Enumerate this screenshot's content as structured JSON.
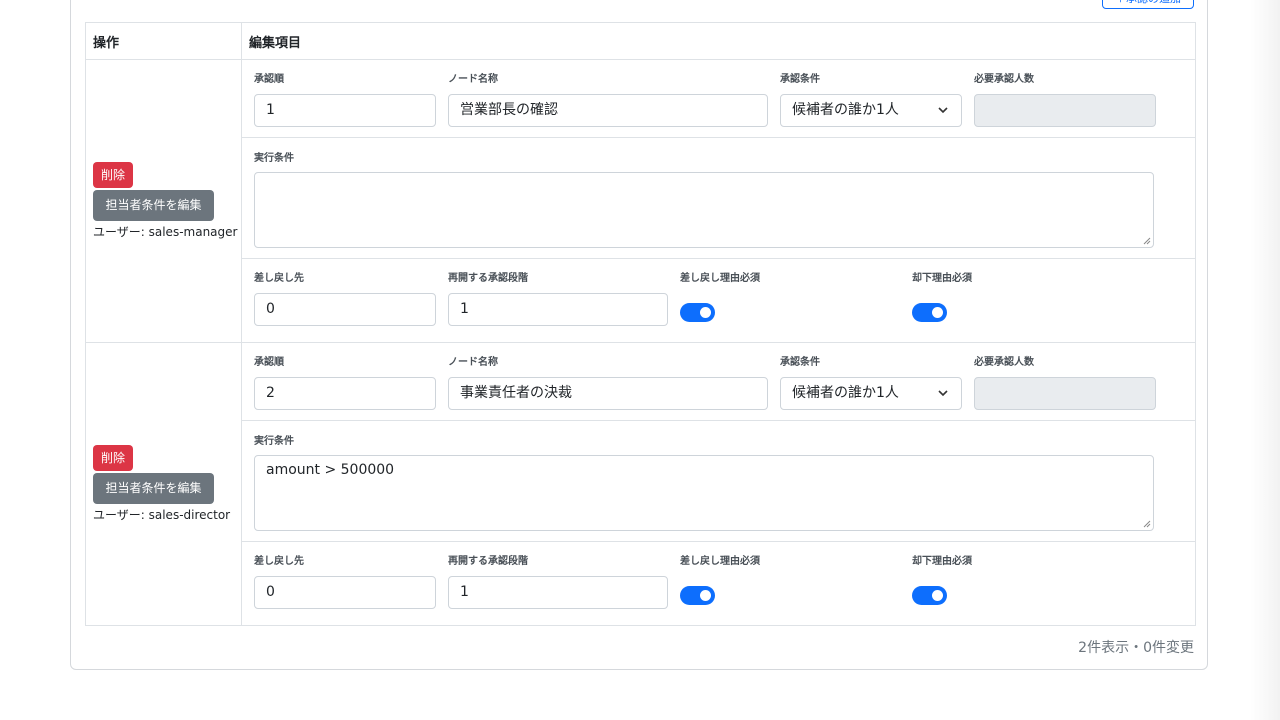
{
  "header": {
    "add_button_label": "＋承認の追加"
  },
  "table": {
    "col_ops": "操作",
    "col_edit": "編集項目"
  },
  "labels": {
    "order": "承認順",
    "node_name": "ノード名称",
    "condition": "承認条件",
    "required_count": "必要承認人数",
    "exec_condition": "実行条件",
    "sendback_to": "差し戻し先",
    "resume_stage": "再開する承認段階",
    "sendback_reason": "差し戻し理由必須",
    "reject_reason": "却下理由必須"
  },
  "buttons": {
    "delete": "削除",
    "edit_assignee": "担当者条件を編集"
  },
  "rows": [
    {
      "user": "ユーザー: sales-manager",
      "order": "1",
      "node_name": "営業部長の確認",
      "condition": "候補者の誰か1人",
      "required_count": "",
      "exec_condition": "",
      "sendback_to": "0",
      "resume_stage": "1",
      "sendback_reason_required": true,
      "reject_reason_required": true
    },
    {
      "user": "ユーザー: sales-director",
      "order": "2",
      "node_name": "事業責任者の決裁",
      "condition": "候補者の誰か1人",
      "required_count": "",
      "exec_condition": "amount > 500000",
      "sendback_to": "0",
      "resume_stage": "1",
      "sendback_reason_required": true,
      "reject_reason_required": true
    }
  ],
  "footer": {
    "summary": "2件表示・0件変更"
  },
  "colors": {
    "primary": "#0d6efd",
    "danger": "#dc3545",
    "secondary": "#6c757d"
  }
}
